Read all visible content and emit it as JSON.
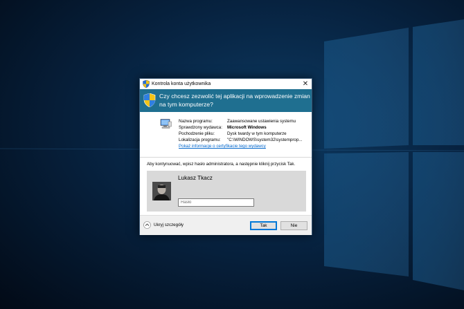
{
  "dialog": {
    "title": "Kontrola konta użytkownika",
    "question": "Czy chcesz zezwolić tej aplikacji na wprowadzenie zmian na tym komputerze?",
    "details": [
      {
        "label": "Nazwa programu:",
        "value": "Zaawansowane ustawienia systemu",
        "bold": false
      },
      {
        "label": "Sprawdzony wydawca:",
        "value": "Microsoft Windows",
        "bold": true
      },
      {
        "label": "Pochodzenie pliku:",
        "value": "Dysk twardy w tym komputerze",
        "bold": false
      },
      {
        "label": "Lokalizacja programu:",
        "value": "\"C:\\WINDOWS\\system32\\systemprop...",
        "bold": false
      }
    ],
    "cert_link": "Pokaż informacje o certyfikacie tego wydawcy",
    "instruction": "Aby kontynuować, wpisz hasło administratora, a następnie kliknij przycisk Tak.",
    "user_name": "Lukasz Tkacz",
    "password_placeholder": "Hasło",
    "password_value": "",
    "toggle_details": "Ukryj szczegóły",
    "yes_button": "Tak",
    "no_button": "Nie"
  },
  "icons": {
    "title": "uac-shield-icon",
    "banner": "uac-shield-icon",
    "program": "computer-icon",
    "close": "close-icon",
    "toggle": "chevron-up-icon",
    "avatar": "user-avatar"
  },
  "colors": {
    "banner": "#1f6f90",
    "link": "#0066cc",
    "credential_panel": "#d9d9d9",
    "footer": "#f0f0f0",
    "default_button_border": "#0078d7"
  }
}
